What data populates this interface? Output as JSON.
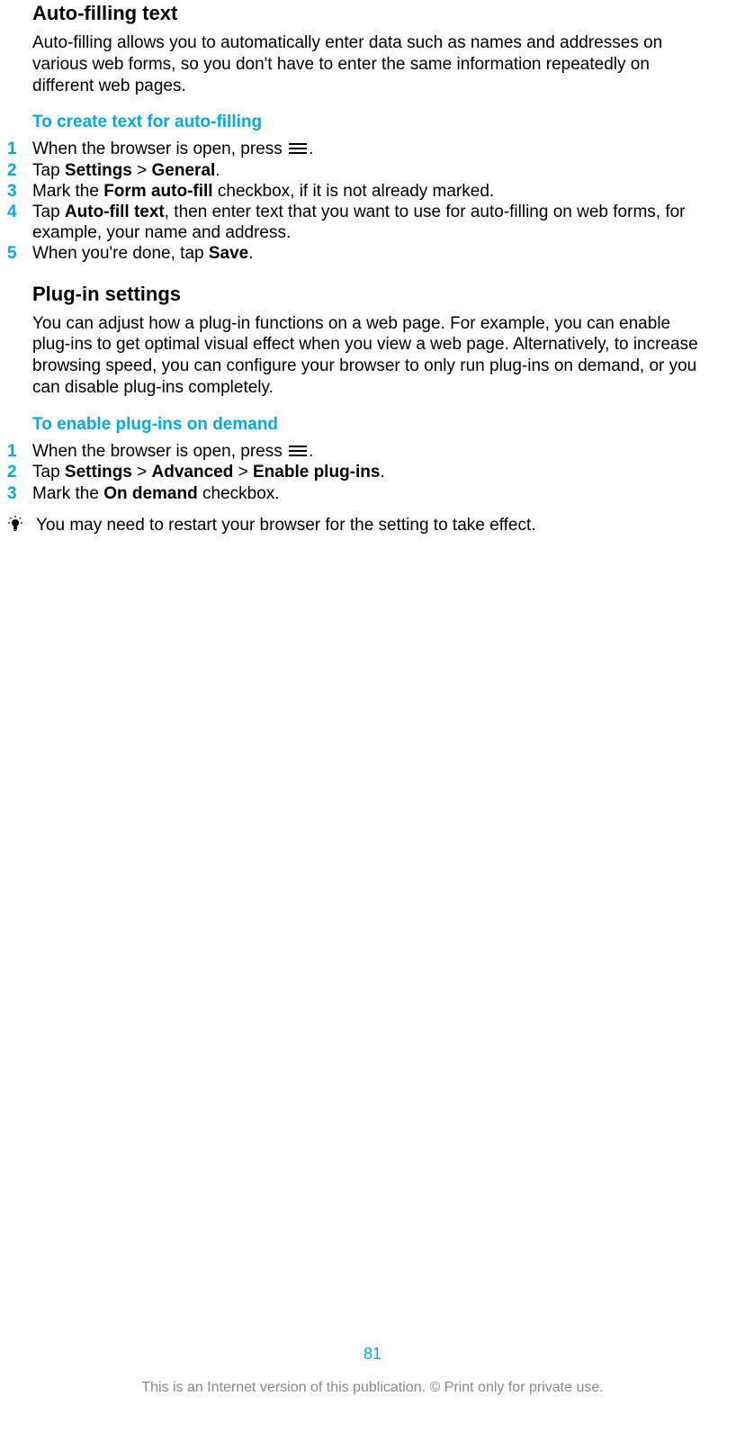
{
  "section1": {
    "heading": "Auto-filling text",
    "body": "Auto-filling allows you to automatically enter data such as names and addresses on various web forms, so you don't have to enter the same information repeatedly on different web pages.",
    "sub_heading": "To create text for auto-filling",
    "steps": [
      {
        "num": "1",
        "pre": "When the browser is open, press ",
        "post": "."
      },
      {
        "num": "2",
        "pre": "Tap ",
        "b1": "Settings",
        "mid1": " > ",
        "b2": "General",
        "post": "."
      },
      {
        "num": "3",
        "pre": "Mark the ",
        "b1": "Form auto-fill",
        "post": " checkbox, if it is not already marked."
      },
      {
        "num": "4",
        "pre": "Tap ",
        "b1": "Auto-fill text",
        "post": ", then enter text that you want to use for auto-filling on web forms, for example, your name and address."
      },
      {
        "num": "5",
        "pre": "When you're done, tap ",
        "b1": "Save",
        "post": "."
      }
    ]
  },
  "section2": {
    "heading": "Plug-in settings",
    "body": "You can adjust how a plug-in functions on a web page. For example, you can enable plug-ins to get optimal visual effect when you view a web page. Alternatively, to increase browsing speed, you can configure your browser to only run plug-ins on demand, or you can disable plug-ins completely.",
    "sub_heading": "To enable plug-ins on demand",
    "steps": [
      {
        "num": "1",
        "pre": "When the browser is open, press ",
        "post": "."
      },
      {
        "num": "2",
        "pre": "Tap ",
        "b1": "Settings",
        "mid1": " > ",
        "b2": "Advanced",
        "mid2": " > ",
        "b3": "Enable plug-ins",
        "post": "."
      },
      {
        "num": "3",
        "pre": "Mark the ",
        "b1": "On demand",
        "post": " checkbox."
      }
    ],
    "tip": "You may need to restart your browser for the setting to take effect."
  },
  "footer": {
    "page_num": "81",
    "note": "This is an Internet version of this publication. © Print only for private use."
  }
}
